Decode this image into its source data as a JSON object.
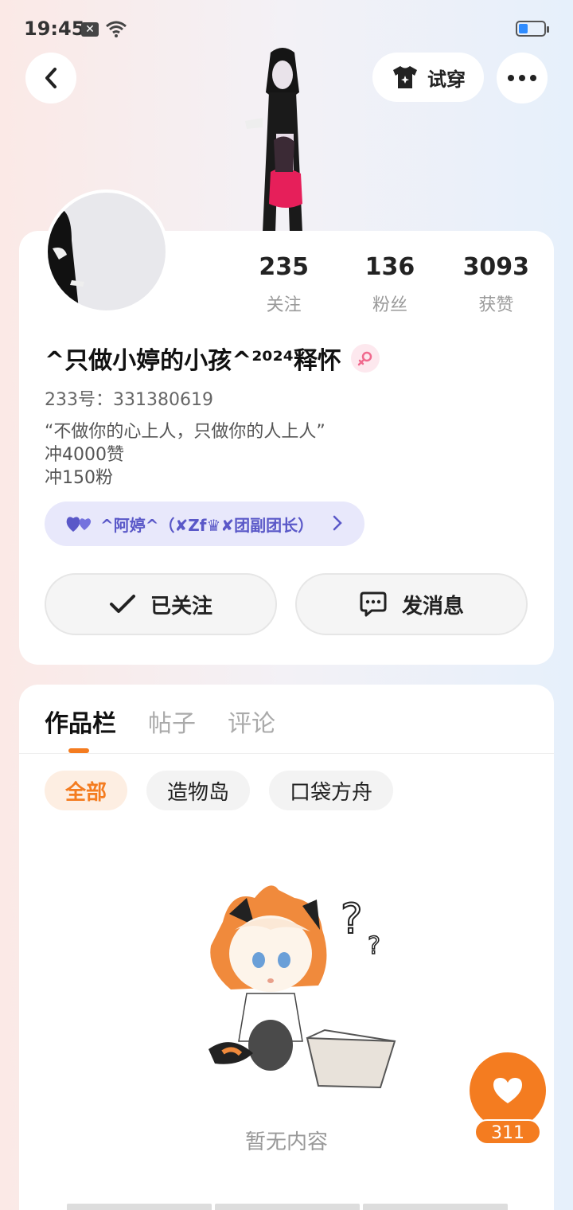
{
  "status_bar": {
    "time": "19:45",
    "battery_level": 0.35
  },
  "header": {
    "try_on_label": "试穿"
  },
  "profile": {
    "stats": [
      {
        "value": "235",
        "label": "关注"
      },
      {
        "value": "136",
        "label": "粉丝"
      },
      {
        "value": "3093",
        "label": "获赞"
      }
    ],
    "nickname": "^只做小婷的小孩^²⁰²⁴释怀",
    "uid": "233号：331380619",
    "bio_lines": [
      "“不做你的心上人，只做你的人上人”",
      "冲4000赞",
      "冲150粉"
    ],
    "guild": "^阿婷^（✘Zf♛✘团副团长）",
    "follow_label": "已关注",
    "message_label": "发消息"
  },
  "works": {
    "tabs": [
      "作品栏",
      "帖子",
      "评论"
    ],
    "filters": [
      "全部",
      "造物岛",
      "口袋方舟"
    ],
    "empty_text": "暂无内容"
  },
  "fab": {
    "like_count": "311"
  },
  "colors": {
    "accent": "#f47c20",
    "guild_text": "#5a58c8",
    "guild_bg": "#e8e8fb"
  }
}
